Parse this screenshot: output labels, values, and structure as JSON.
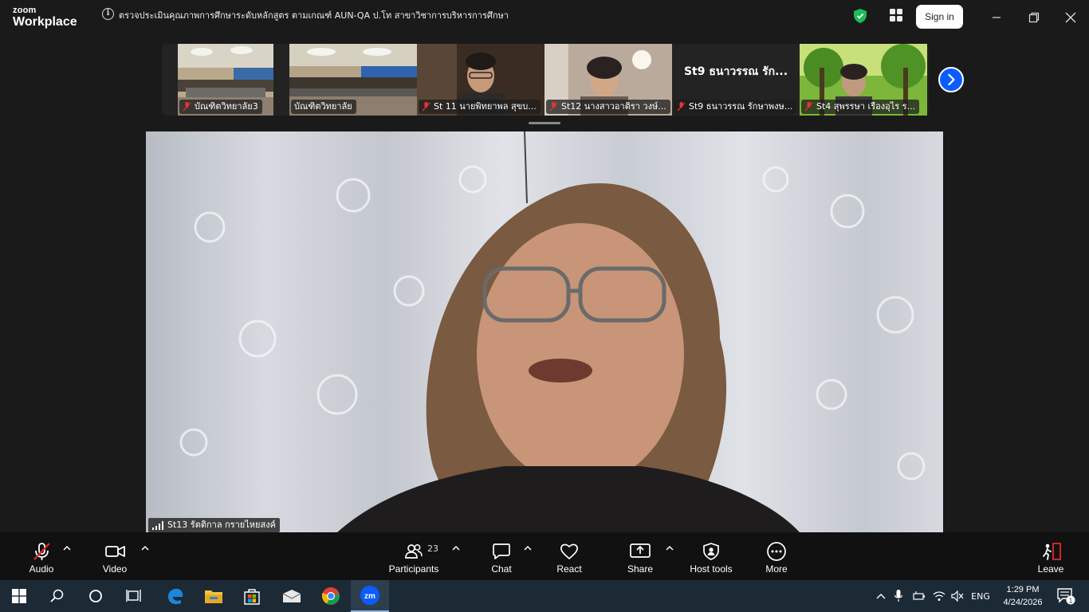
{
  "app": {
    "logo_top": "zoom",
    "logo_bottom": "Workplace"
  },
  "meeting": {
    "title": "ตรวจประเมินคุณภาพการศึกษาระดับหลักสูตร ตามเกณฑ์ AUN-QA ป.โท สาขาวิชาการบริหารการศึกษา"
  },
  "header": {
    "signin_label": "Sign in"
  },
  "thumbnails": [
    {
      "label": "บัณฑิตวิทยาลัย3",
      "muted": true,
      "kind": "room"
    },
    {
      "label": "บัณฑิตวิทยาลัย",
      "muted": false,
      "kind": "room"
    },
    {
      "label": "St 11 นายพิทยาพล สุขบ...",
      "muted": true,
      "kind": "person"
    },
    {
      "label": "St12 นางสาวอาติรา วงษ์...",
      "muted": true,
      "kind": "person"
    },
    {
      "label": "St9 ธนาวรรณ รักษาพงษ...",
      "muted": true,
      "kind": "name",
      "big_name": "St9 ธนาวรรณ รัก..."
    },
    {
      "label": "St4 สุพรรษา  เรืองอุไร  ร...",
      "muted": true,
      "kind": "forest"
    }
  ],
  "main_speaker": {
    "label": "St13 รัตติกาล  กรายไหยสงค์"
  },
  "toolbar": {
    "audio": "Audio",
    "video": "Video",
    "participants": "Participants",
    "participants_count": "23",
    "chat": "Chat",
    "react": "React",
    "share": "Share",
    "host_tools": "Host tools",
    "more": "More",
    "leave": "Leave"
  },
  "taskbar": {
    "language": "ENG",
    "time": "1:29 PM",
    "date": "4/24/2026",
    "notification_count": "1"
  },
  "colors": {
    "accent": "#0b5cff",
    "leave": "#e02828",
    "shield": "#1fbb5a"
  }
}
